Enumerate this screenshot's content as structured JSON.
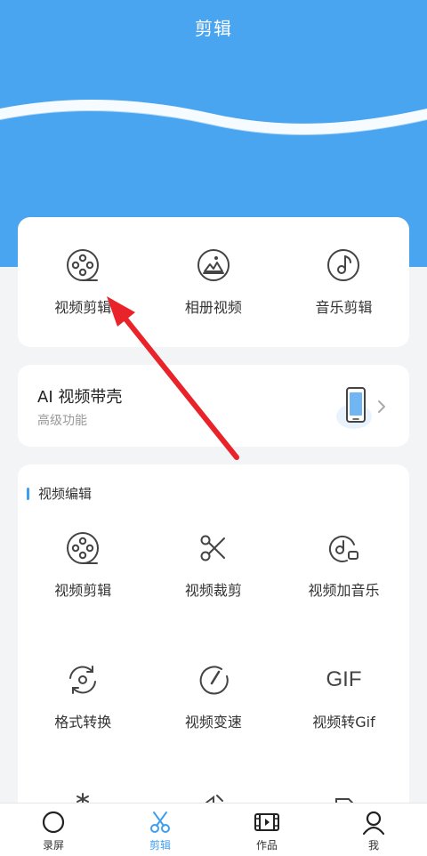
{
  "header": {
    "title": "剪辑"
  },
  "quick_actions": [
    {
      "label": "视频剪辑",
      "icon": "film-reel-icon"
    },
    {
      "label": "相册视频",
      "icon": "photo-album-icon"
    },
    {
      "label": "音乐剪辑",
      "icon": "music-note-icon"
    }
  ],
  "ai_card": {
    "title": "AI 视频带壳",
    "subtitle": "高级功能",
    "icon": "phone-icon"
  },
  "video_edit": {
    "section_title": "视频编辑",
    "items": [
      {
        "label": "视频剪辑",
        "icon": "film-reel-icon"
      },
      {
        "label": "视频裁剪",
        "icon": "scissors-icon"
      },
      {
        "label": "视频加音乐",
        "icon": "add-music-icon"
      },
      {
        "label": "格式转换",
        "icon": "format-convert-icon"
      },
      {
        "label": "视频变速",
        "icon": "speedometer-icon"
      },
      {
        "label": "视频转Gif",
        "icon": "gif-icon",
        "icon_text": "GIF"
      }
    ]
  },
  "bottom_nav": [
    {
      "label": "录屏",
      "icon": "record-icon",
      "active": false
    },
    {
      "label": "剪辑",
      "icon": "scissors-icon",
      "active": true
    },
    {
      "label": "作品",
      "icon": "film-strip-icon",
      "active": false
    },
    {
      "label": "我",
      "icon": "user-icon",
      "active": false
    }
  ],
  "colors": {
    "primary": "#4aa5f0",
    "accent": "#3e9ef0",
    "annotation": "#e8232a"
  }
}
